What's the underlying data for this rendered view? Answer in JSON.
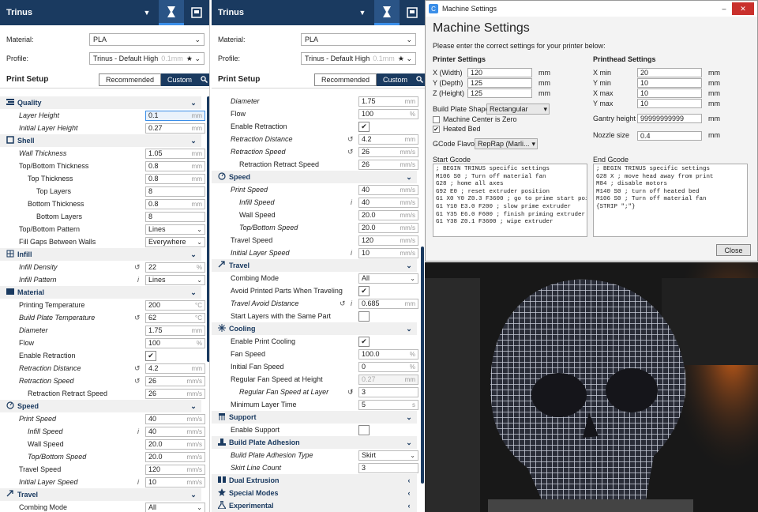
{
  "left": {
    "header": {
      "title": "Trinus"
    },
    "material": {
      "label": "Material:",
      "value": "PLA"
    },
    "profile": {
      "label": "Profile:",
      "value": "Trinus - Default High",
      "hint": "0.1mm"
    },
    "print_setup": {
      "title": "Print Setup",
      "recommended": "Recommended",
      "custom": "Custom"
    },
    "rows": [
      {
        "k": "sec",
        "name": "section-quality",
        "icon": "quality",
        "t": "Quality"
      },
      {
        "k": "f",
        "name": "layer-height",
        "t": "Layer Height",
        "it": true,
        "ind": 0,
        "v": "0.1",
        "u": "mm",
        "hl": true
      },
      {
        "k": "f",
        "name": "initial-layer-height",
        "t": "Initial Layer Height",
        "it": true,
        "ind": 0,
        "v": "0.27",
        "u": "mm"
      },
      {
        "k": "sec",
        "name": "section-shell",
        "icon": "shell",
        "t": "Shell"
      },
      {
        "k": "f",
        "name": "wall-thickness",
        "t": "Wall Thickness",
        "it": true,
        "ind": 0,
        "v": "1.05",
        "u": "mm"
      },
      {
        "k": "f",
        "name": "top-bottom-thickness",
        "t": "Top/Bottom Thickness",
        "ind": 0,
        "v": "0.8",
        "u": "mm"
      },
      {
        "k": "f",
        "name": "top-thickness",
        "t": "Top Thickness",
        "ind": 1,
        "v": "0.8",
        "u": "mm"
      },
      {
        "k": "f",
        "name": "top-layers",
        "t": "Top Layers",
        "ind": 2,
        "v": "8",
        "u": ""
      },
      {
        "k": "f",
        "name": "bottom-thickness",
        "t": "Bottom Thickness",
        "ind": 1,
        "v": "0.8",
        "u": "mm"
      },
      {
        "k": "f",
        "name": "bottom-layers",
        "t": "Bottom Layers",
        "ind": 2,
        "v": "8",
        "u": ""
      },
      {
        "k": "d",
        "name": "top-bottom-pattern",
        "t": "Top/Bottom Pattern",
        "ind": 0,
        "v": "Lines"
      },
      {
        "k": "d",
        "name": "fill-gaps-between-walls",
        "t": "Fill Gaps Between Walls",
        "ind": 0,
        "v": "Everywhere"
      },
      {
        "k": "sec",
        "name": "section-infill",
        "icon": "infill",
        "t": "Infill"
      },
      {
        "k": "f",
        "name": "infill-density",
        "t": "Infill Density",
        "it": true,
        "ind": 0,
        "v": "22",
        "u": "%",
        "reset": true
      },
      {
        "k": "d",
        "name": "infill-pattern",
        "t": "Infill Pattern",
        "it": true,
        "ind": 0,
        "v": "Lines",
        "info": true
      },
      {
        "k": "sec",
        "name": "section-material",
        "icon": "material",
        "t": "Material"
      },
      {
        "k": "f",
        "name": "printing-temperature",
        "t": "Printing Temperature",
        "ind": 0,
        "v": "200",
        "u": "°C"
      },
      {
        "k": "f",
        "name": "build-plate-temperature",
        "t": "Build Plate Temperature",
        "it": true,
        "ind": 0,
        "v": "62",
        "u": "°C",
        "reset": true
      },
      {
        "k": "f",
        "name": "diameter",
        "t": "Diameter",
        "it": true,
        "ind": 0,
        "v": "1.75",
        "u": "mm"
      },
      {
        "k": "f",
        "name": "flow",
        "t": "Flow",
        "ind": 0,
        "v": "100",
        "u": "%"
      },
      {
        "k": "c",
        "name": "enable-retraction",
        "t": "Enable Retraction",
        "ind": 0,
        "v": "✔"
      },
      {
        "k": "f",
        "name": "retraction-distance",
        "t": "Retraction Distance",
        "it": true,
        "ind": 0,
        "v": "4.2",
        "u": "mm",
        "reset": true
      },
      {
        "k": "f",
        "name": "retraction-speed",
        "t": "Retraction Speed",
        "it": true,
        "ind": 0,
        "v": "26",
        "u": "mm/s",
        "reset": true
      },
      {
        "k": "f",
        "name": "retraction-retract-speed",
        "t": "Retraction Retract Speed",
        "ind": 1,
        "v": "26",
        "u": "mm/s"
      },
      {
        "k": "sec",
        "name": "section-speed",
        "icon": "speed",
        "t": "Speed"
      },
      {
        "k": "f",
        "name": "print-speed",
        "t": "Print Speed",
        "it": true,
        "ind": 0,
        "v": "40",
        "u": "mm/s"
      },
      {
        "k": "f",
        "name": "infill-speed",
        "t": "Infill Speed",
        "it": true,
        "ind": 1,
        "v": "40",
        "u": "mm/s",
        "info": true
      },
      {
        "k": "f",
        "name": "wall-speed",
        "t": "Wall Speed",
        "ind": 1,
        "v": "20.0",
        "u": "mm/s"
      },
      {
        "k": "f",
        "name": "top-bottom-speed",
        "t": "Top/Bottom Speed",
        "it": true,
        "ind": 1,
        "v": "20.0",
        "u": "mm/s"
      },
      {
        "k": "f",
        "name": "travel-speed",
        "t": "Travel Speed",
        "ind": 0,
        "v": "120",
        "u": "mm/s"
      },
      {
        "k": "f",
        "name": "initial-layer-speed",
        "t": "Initial Layer Speed",
        "it": true,
        "ind": 0,
        "v": "10",
        "u": "mm/s",
        "info": true
      },
      {
        "k": "sec",
        "name": "section-travel",
        "icon": "travel",
        "t": "Travel"
      },
      {
        "k": "d",
        "name": "combing-mode",
        "t": "Combing Mode",
        "ind": 0,
        "v": "All"
      }
    ]
  },
  "right": {
    "header": {
      "title": "Trinus"
    },
    "material": {
      "label": "Material:",
      "value": "PLA"
    },
    "profile": {
      "label": "Profile:",
      "value": "Trinus - Default High",
      "hint": "0.1mm"
    },
    "print_setup": {
      "title": "Print Setup",
      "recommended": "Recommended",
      "custom": "Custom"
    },
    "rows": [
      {
        "k": "f",
        "name": "diameter",
        "t": "Diameter",
        "it": true,
        "ind": 0,
        "v": "1.75",
        "u": "mm"
      },
      {
        "k": "f",
        "name": "flow",
        "t": "Flow",
        "ind": 0,
        "v": "100",
        "u": "%"
      },
      {
        "k": "c",
        "name": "enable-retraction",
        "t": "Enable Retraction",
        "ind": 0,
        "v": "✔"
      },
      {
        "k": "f",
        "name": "retraction-distance",
        "t": "Retraction Distance",
        "it": true,
        "ind": 0,
        "v": "4.2",
        "u": "mm",
        "reset": true
      },
      {
        "k": "f",
        "name": "retraction-speed",
        "t": "Retraction Speed",
        "it": true,
        "ind": 0,
        "v": "26",
        "u": "mm/s",
        "reset": true
      },
      {
        "k": "f",
        "name": "retraction-retract-speed",
        "t": "Retraction Retract Speed",
        "ind": 1,
        "v": "26",
        "u": "mm/s"
      },
      {
        "k": "sec",
        "name": "section-speed",
        "icon": "speed",
        "t": "Speed"
      },
      {
        "k": "f",
        "name": "print-speed",
        "t": "Print Speed",
        "it": true,
        "ind": 0,
        "v": "40",
        "u": "mm/s"
      },
      {
        "k": "f",
        "name": "infill-speed",
        "t": "Infill Speed",
        "it": true,
        "ind": 1,
        "v": "40",
        "u": "mm/s",
        "info": true
      },
      {
        "k": "f",
        "name": "wall-speed",
        "t": "Wall Speed",
        "ind": 1,
        "v": "20.0",
        "u": "mm/s"
      },
      {
        "k": "f",
        "name": "top-bottom-speed",
        "t": "Top/Bottom Speed",
        "it": true,
        "ind": 1,
        "v": "20.0",
        "u": "mm/s"
      },
      {
        "k": "f",
        "name": "travel-speed",
        "t": "Travel Speed",
        "ind": 0,
        "v": "120",
        "u": "mm/s"
      },
      {
        "k": "f",
        "name": "initial-layer-speed",
        "t": "Initial Layer Speed",
        "it": true,
        "ind": 0,
        "v": "10",
        "u": "mm/s",
        "info": true
      },
      {
        "k": "sec",
        "name": "section-travel",
        "icon": "travel",
        "t": "Travel"
      },
      {
        "k": "d",
        "name": "combing-mode",
        "t": "Combing Mode",
        "ind": 0,
        "v": "All"
      },
      {
        "k": "c",
        "name": "avoid-printed-parts",
        "t": "Avoid Printed Parts When Traveling",
        "ind": 0,
        "v": "✔"
      },
      {
        "k": "f",
        "name": "travel-avoid-distance",
        "t": "Travel Avoid Distance",
        "it": true,
        "ind": 0,
        "v": "0.685",
        "u": "mm",
        "reset": true,
        "info": true
      },
      {
        "k": "c",
        "name": "start-layers-same-part",
        "t": "Start Layers with the Same Part",
        "ind": 0,
        "v": ""
      },
      {
        "k": "sec",
        "name": "section-cooling",
        "icon": "cooling",
        "t": "Cooling"
      },
      {
        "k": "c",
        "name": "enable-print-cooling",
        "t": "Enable Print Cooling",
        "ind": 0,
        "v": "✔"
      },
      {
        "k": "f",
        "name": "fan-speed",
        "t": "Fan Speed",
        "ind": 0,
        "v": "100.0",
        "u": "%"
      },
      {
        "k": "f",
        "name": "initial-fan-speed",
        "t": "Initial Fan Speed",
        "ind": 0,
        "v": "0",
        "u": "%"
      },
      {
        "k": "f",
        "name": "regular-fan-speed-height",
        "t": "Regular Fan Speed at Height",
        "ind": 0,
        "v": "0.27",
        "u": "mm",
        "dis": true
      },
      {
        "k": "f",
        "name": "regular-fan-speed-layer",
        "t": "Regular Fan Speed at Layer",
        "it": true,
        "ind": 1,
        "v": "3",
        "u": "",
        "reset": true,
        "info": true
      },
      {
        "k": "f",
        "name": "minimum-layer-time",
        "t": "Minimum Layer Time",
        "ind": 0,
        "v": "5",
        "u": "s"
      },
      {
        "k": "sec",
        "name": "section-support",
        "icon": "support",
        "t": "Support"
      },
      {
        "k": "c",
        "name": "enable-support",
        "t": "Enable Support",
        "ind": 0,
        "v": ""
      },
      {
        "k": "sec",
        "name": "section-build-plate-adhesion",
        "icon": "adhesion",
        "t": "Build Plate Adhesion"
      },
      {
        "k": "d",
        "name": "build-plate-adhesion-type",
        "t": "Build Plate Adhesion Type",
        "it": true,
        "ind": 0,
        "v": "Skirt"
      },
      {
        "k": "f",
        "name": "skirt-line-count",
        "t": "Skirt Line Count",
        "it": true,
        "ind": 0,
        "v": "3",
        "u": ""
      },
      {
        "k": "sec",
        "name": "section-dual-extrusion",
        "icon": "dual",
        "t": "Dual Extrusion",
        "collapsed": true
      },
      {
        "k": "sec",
        "name": "section-special-modes",
        "icon": "special",
        "t": "Special Modes",
        "collapsed": true
      },
      {
        "k": "sec",
        "name": "section-experimental",
        "icon": "experimental",
        "t": "Experimental",
        "collapsed": true
      }
    ]
  },
  "dialog": {
    "window_title": "Machine Settings",
    "heading": "Machine Settings",
    "subtitle": "Please enter the correct settings for your printer below:",
    "printer": {
      "title": "Printer Settings",
      "fields": [
        {
          "label": "X (Width)",
          "value": "120",
          "unit": "mm"
        },
        {
          "label": "Y (Depth)",
          "value": "125",
          "unit": "mm"
        },
        {
          "label": "Z (Height)",
          "value": "125",
          "unit": "mm"
        }
      ],
      "build_plate_shape_label": "Build Plate Shape",
      "build_plate_shape": "Rectangular",
      "machine_center_zero": "Machine Center is Zero",
      "heated_bed": "Heated Bed",
      "gcode_flavor_label": "GCode Flavor",
      "gcode_flavor": "RepRap (Marli..."
    },
    "printhead": {
      "title": "Printhead Settings",
      "fields": [
        {
          "label": "X min",
          "value": "20",
          "unit": "mm"
        },
        {
          "label": "Y min",
          "value": "10",
          "unit": "mm"
        },
        {
          "label": "X max",
          "value": "10",
          "unit": "mm"
        },
        {
          "label": "Y max",
          "value": "10",
          "unit": "mm"
        }
      ],
      "gantry_label": "Gantry height",
      "gantry_value": "99999999999",
      "gantry_unit": "mm",
      "nozzle_label": "Nozzle size",
      "nozzle_value": "0.4",
      "nozzle_unit": "mm"
    },
    "start_gcode_label": "Start Gcode",
    "start_gcode": [
      "; BEGIN TRINUS specific settings",
      "M106 S0 ; Turn off material fan",
      "G28 ; home all axes",
      "G92 E0 ; reset extruder position",
      "G1 X0 Y0 Z0.3 F3600 ; go to prime start poi",
      "G1 Y10 E3.0 F200 ; slow prime extruder",
      "G1 Y35 E6.0 F600 ; finish priming extruder",
      "G1 Y38 Z0.1 F3600 ; wipe extruder"
    ],
    "end_gcode_label": "End Gcode",
    "end_gcode": [
      "; BEGIN TRINUS specific settings",
      "G28 X ; move head away from print",
      "M84 ; disable motors",
      "M140 S0 ; turn off heated bed",
      "M106 S0 ; Turn off material fan",
      "{STRIP \";\"}"
    ],
    "close": "Close"
  },
  "colors": {
    "header_bg": "#1a3a60",
    "accent": "#3a8ee8",
    "close_red": "#c9302c"
  }
}
